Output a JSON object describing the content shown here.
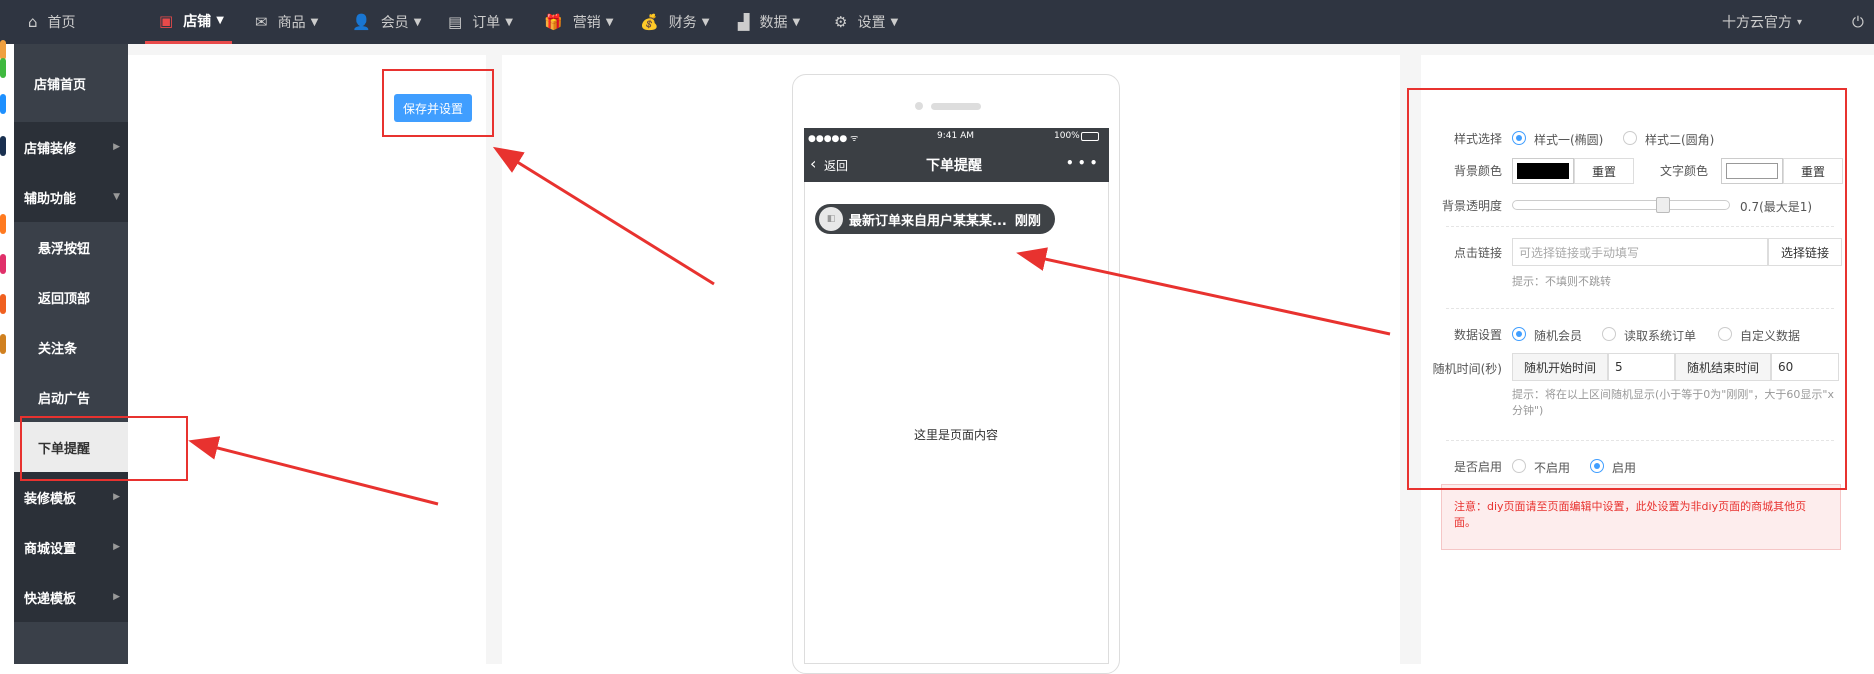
{
  "topnav": {
    "home": "首页",
    "items": [
      {
        "label": "店铺",
        "icon": "store-icon"
      },
      {
        "label": "商品",
        "icon": "goods-icon"
      },
      {
        "label": "会员",
        "icon": "member-icon"
      },
      {
        "label": "订单",
        "icon": "order-icon"
      },
      {
        "label": "营销",
        "icon": "gift-icon"
      },
      {
        "label": "财务",
        "icon": "money-bag-icon"
      },
      {
        "label": "数据",
        "icon": "bar-chart-icon"
      },
      {
        "label": "设置",
        "icon": "gear-icon"
      }
    ],
    "account": "十方云官方",
    "active_color": "#e84a4a"
  },
  "sidebar": {
    "home": "店铺首页",
    "items": [
      {
        "label": "店铺装修",
        "type": "group"
      },
      {
        "label": "辅助功能",
        "type": "group"
      },
      {
        "label": "悬浮按钮",
        "type": "sub"
      },
      {
        "label": "返回顶部",
        "type": "sub"
      },
      {
        "label": "关注条",
        "type": "sub"
      },
      {
        "label": "启动广告",
        "type": "sub"
      },
      {
        "label": "下单提醒",
        "type": "sub",
        "selected": true
      },
      {
        "label": "装修模板",
        "type": "group"
      },
      {
        "label": "商城设置",
        "type": "group"
      },
      {
        "label": "快递模板",
        "type": "group"
      }
    ]
  },
  "toolbar": {
    "save_label": "保存并设置"
  },
  "preview": {
    "status_carrier": "●●●●● ᯤ",
    "status_time": "9:41 AM",
    "status_battery": "100%",
    "back_label": "返回",
    "title": "下单提醒",
    "more": "• • •",
    "notice_text": "最新订单来自用户某某某...",
    "notice_time": "刚刚",
    "page_placeholder": "这里是页面内容"
  },
  "form": {
    "style_label": "样式选择",
    "style_options": [
      "样式一(椭圆)",
      "样式二(圆角)"
    ],
    "bg_color_label": "背景颜色",
    "bg_color": "#000000",
    "reset_label": "重置",
    "text_color_label": "文字颜色",
    "text_color": "#ffffff",
    "opacity_label": "背景透明度",
    "opacity_value": "0.7(最大是1)",
    "opacity": 0.7,
    "link_label": "点击链接",
    "link_placeholder": "可选择链接或手动填写",
    "link_button": "选择链接",
    "link_hint": "提示：不填则不跳转",
    "data_label": "数据设置",
    "data_options": [
      "随机会员",
      "读取系统订单",
      "自定义数据"
    ],
    "random_time_label": "随机时间(秒)",
    "random_start_label": "随机开始时间",
    "random_start_value": "5",
    "random_end_label": "随机结束时间",
    "random_end_value": "60",
    "random_hint": "提示：将在以上区间随机显示(小于等于0为\"刚刚\"，大于60显示\"x分钟\")",
    "enable_label": "是否启用",
    "enable_options": [
      "不启用",
      "启用"
    ],
    "alert": "注意：diy页面请至页面编辑中设置，此处设置为非diy页面的商城其他页面。"
  }
}
